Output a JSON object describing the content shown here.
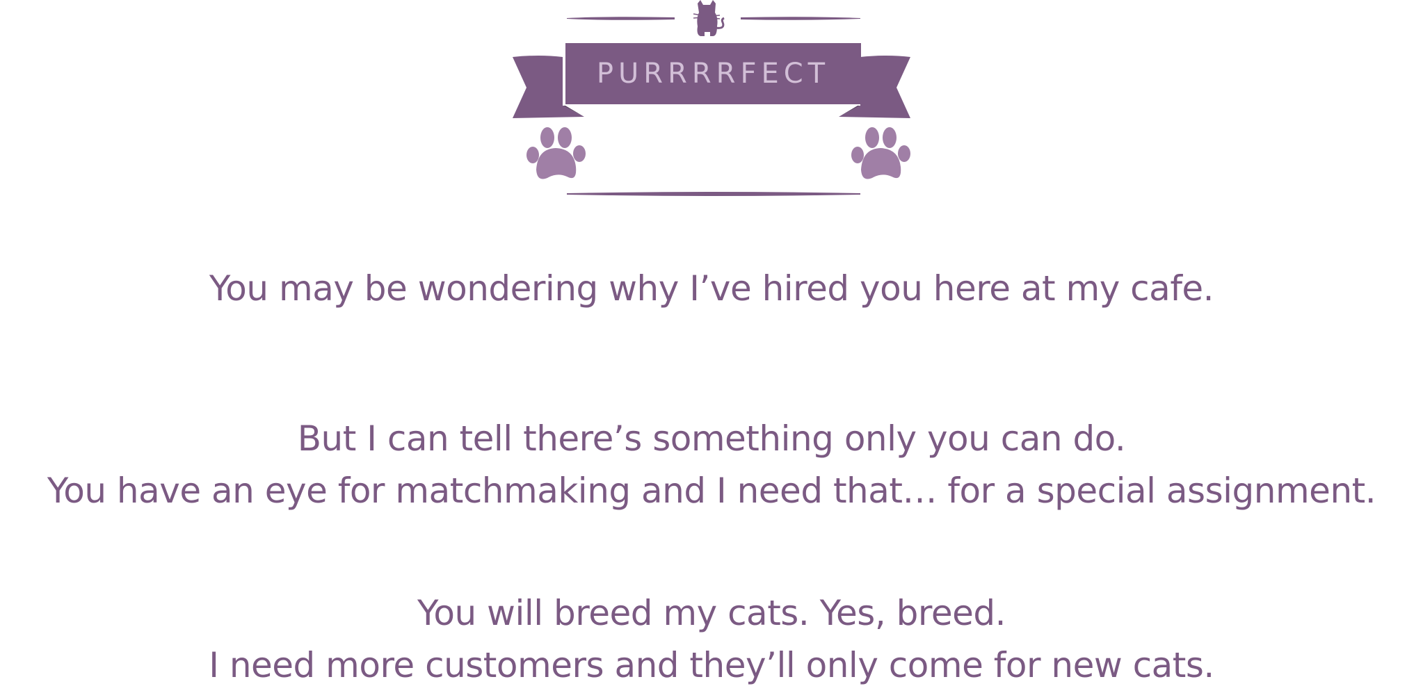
{
  "logo": {
    "title": "PURRRRFECT",
    "icons": [
      "cat-silhouette-icon",
      "paw-print-icon",
      "paw-print-icon"
    ]
  },
  "dialogue": {
    "paragraph_1": [
      "You may be wondering why I’ve hired you here at my cafe."
    ],
    "paragraph_2": [
      "But I can tell there’s something only you can do.",
      "You have an eye for matchmaking and I need that… for a special assignment."
    ],
    "paragraph_3": [
      "You will breed my cats. Yes, breed.",
      "I need more customers and they’ll only come for new cats."
    ]
  },
  "colors": {
    "brand_purple": "#7b5a83",
    "paw_purple": "#a07fa6",
    "banner_text": "#d2bfd7",
    "background": "#ffffff"
  }
}
